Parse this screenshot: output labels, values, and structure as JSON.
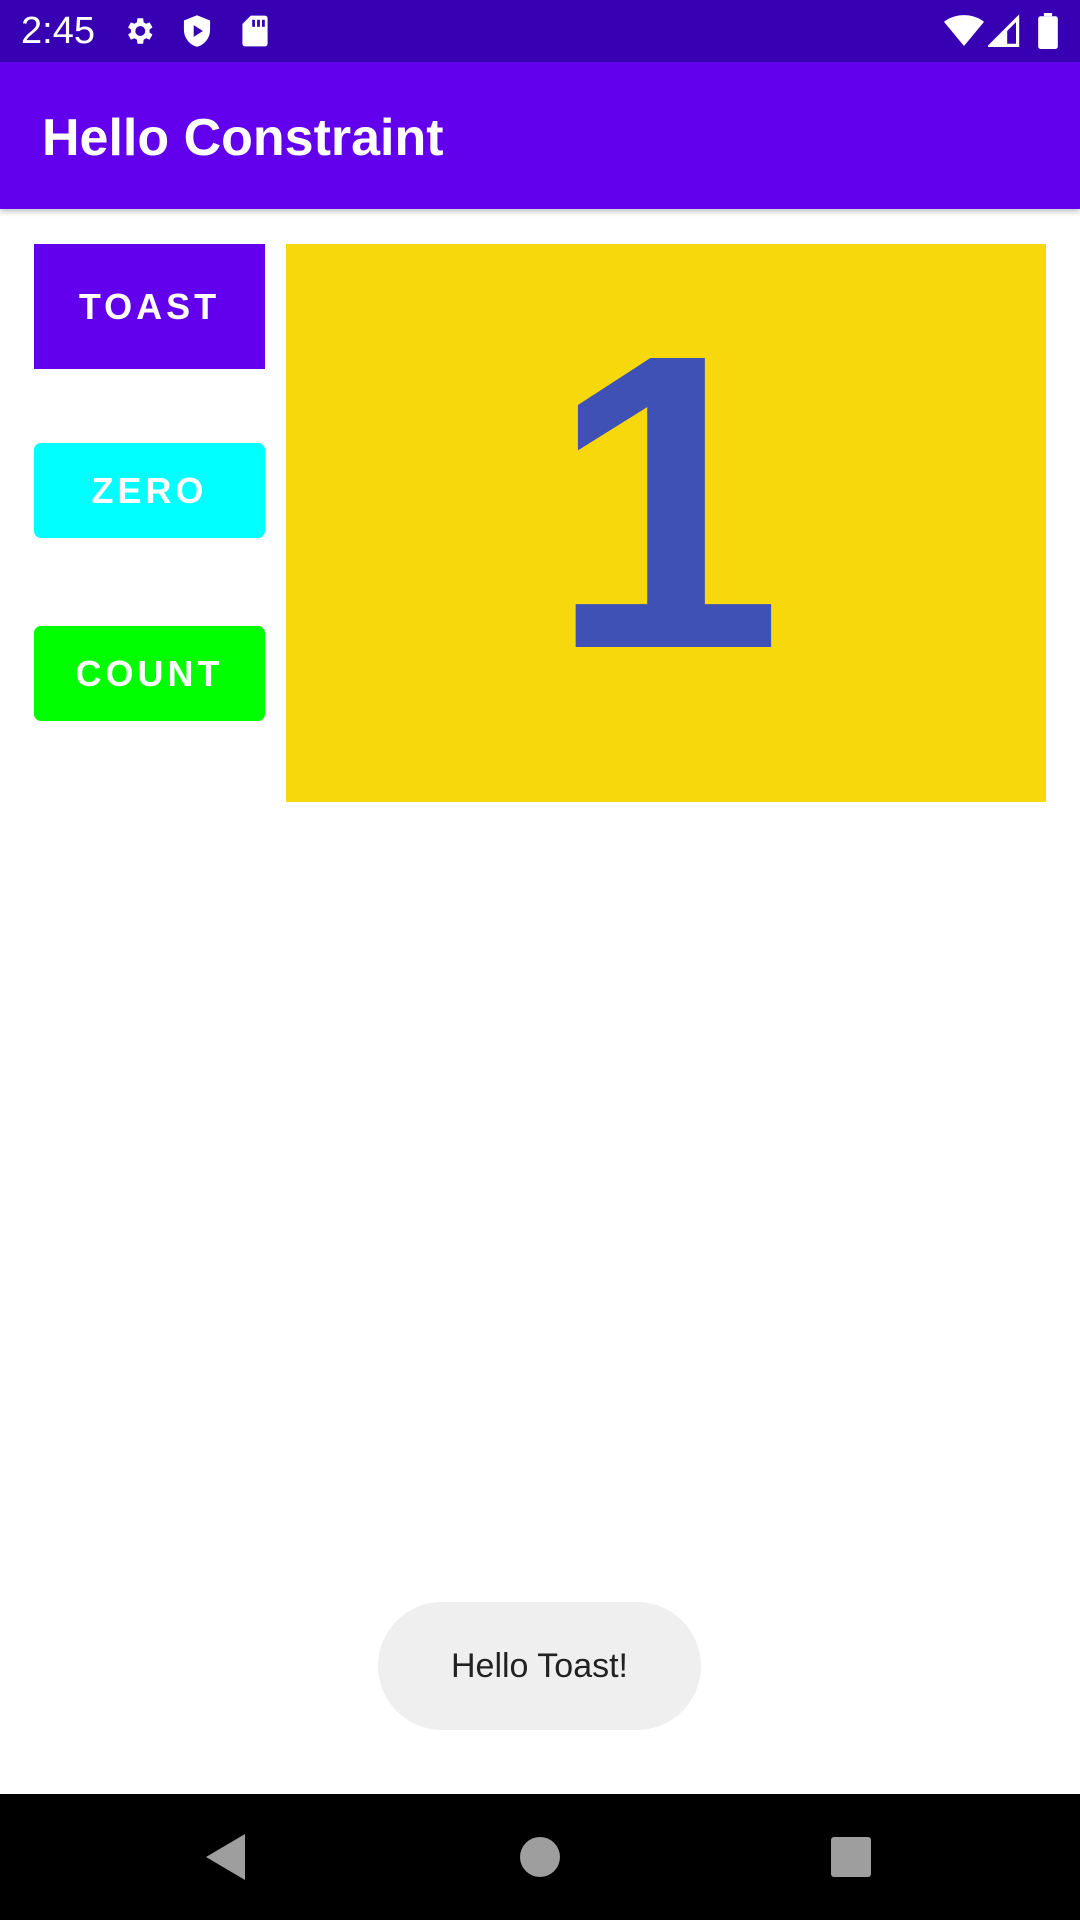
{
  "status_bar": {
    "time": "2:45",
    "background": "#3700b3",
    "left_icons": [
      "gear-icon",
      "shield-play-icon",
      "sd-card-icon"
    ],
    "right_icons": [
      "wifi-icon",
      "cellular-signal-icon",
      "battery-icon"
    ]
  },
  "app_bar": {
    "title": "Hello Constraint",
    "background": "#6200ee"
  },
  "buttons": {
    "toast_label": "TOAST",
    "zero_label": "ZERO",
    "count_label": "COUNT",
    "toast_color": "#6200ee",
    "zero_color": "#00ffff",
    "count_color": "#00ff00"
  },
  "count_panel": {
    "value": "1",
    "background": "#f7d80c",
    "text_color": "#3f51b5"
  },
  "toast_message": {
    "text": "Hello Toast!"
  },
  "nav_bar": {
    "icons": [
      "back-icon",
      "home-icon",
      "recents-icon"
    ]
  }
}
